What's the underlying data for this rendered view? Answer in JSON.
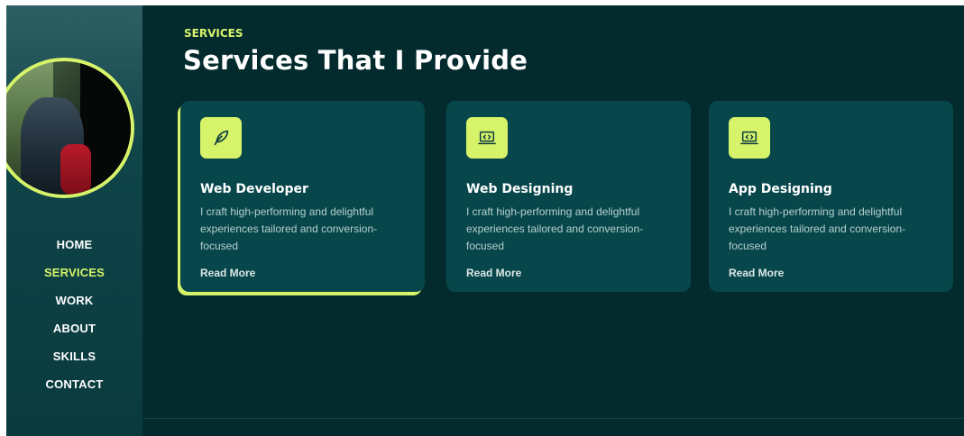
{
  "nav": {
    "items": [
      "HOME",
      "SERVICES",
      "WORK",
      "ABOUT",
      "SKILLS",
      "CONTACT"
    ],
    "active": "SERVICES"
  },
  "header": {
    "eyebrow": "SERVICES",
    "title": "Services That I Provide"
  },
  "cards": [
    {
      "icon": "feather-pen-icon",
      "title": "Web Developer",
      "description": "I craft high-performing and delightful experiences tailored and conversion-focused",
      "link": "Read More"
    },
    {
      "icon": "laptop-code-icon",
      "title": "Web Designing",
      "description": "I craft high-performing and delightful experiences tailored and conversion-focused",
      "link": "Read More"
    },
    {
      "icon": "laptop-code-icon",
      "title": "App Designing",
      "description": "I craft high-performing and delightful experiences tailored and conversion-focused",
      "link": "Read More"
    }
  ],
  "colors": {
    "accent": "#d7f36a",
    "background": "#032b2e",
    "card": "#07474b",
    "sidebar": "#0a3a3e"
  }
}
